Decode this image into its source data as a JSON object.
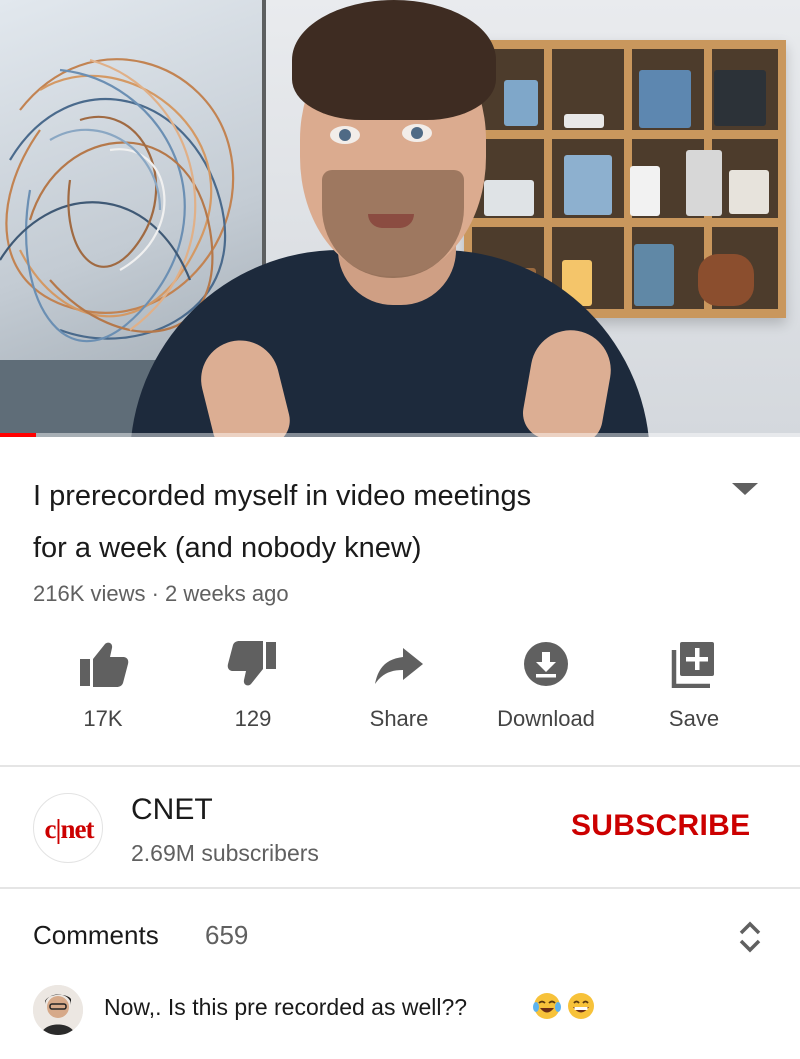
{
  "video": {
    "progress_fraction": 0.045
  },
  "info": {
    "title_line1": "I prerecorded myself in video meetings",
    "title_line2": "for a week (and nobody knew)",
    "meta": "216K views · 2 weeks ago",
    "expand_icon": "chevron-down-icon"
  },
  "actions": {
    "like": {
      "label": "17K",
      "icon": "thumbs-up-icon"
    },
    "dislike": {
      "label": "129",
      "icon": "thumbs-down-icon"
    },
    "share": {
      "label": "Share",
      "icon": "share-arrow-icon"
    },
    "download": {
      "label": "Download",
      "icon": "download-icon"
    },
    "save": {
      "label": "Save",
      "icon": "playlist-add-icon"
    }
  },
  "channel": {
    "logo_text": "c|net",
    "name": "CNET",
    "subscribers": "2.69M subscribers",
    "subscribe_label": "SUBSCRIBE"
  },
  "comments": {
    "label": "Comments",
    "count": "659",
    "toggle_icon": "expand-collapse-icon",
    "top_comment": {
      "text": "Now,. Is this pre recorded as well??",
      "emojis": [
        "face-with-tears-of-joy-icon",
        "grinning-face-icon"
      ]
    }
  },
  "colors": {
    "accent": "#cc0000",
    "progress": "#ff0000",
    "secondary_text": "#606060",
    "icon_gray": "#606060"
  }
}
